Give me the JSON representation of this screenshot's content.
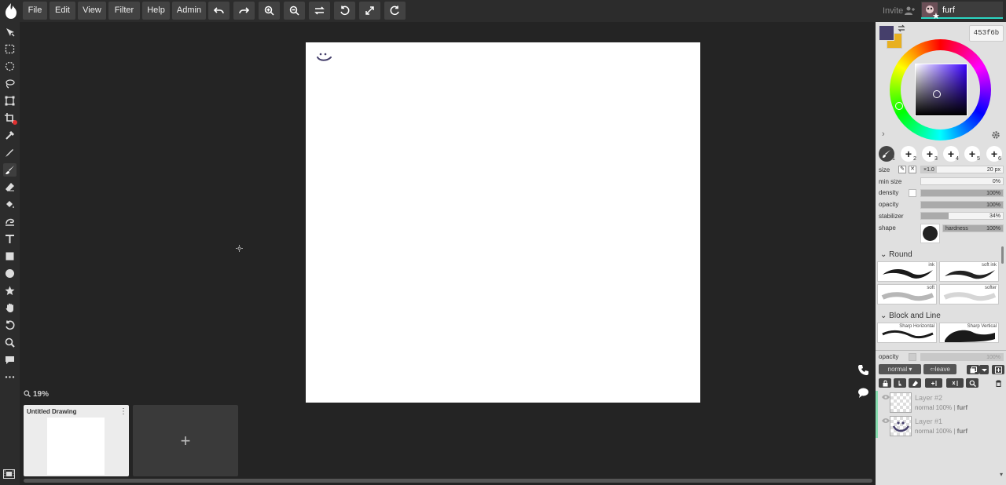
{
  "menu": {
    "file": "File",
    "edit": "Edit",
    "view": "View",
    "filter": "Filter",
    "help": "Help",
    "admin": "Admin"
  },
  "toolbar_icons": [
    "undo-icon",
    "redo-icon",
    "zoom-in-icon",
    "zoom-out-icon",
    "flip-icon",
    "rotate-icon",
    "fullscreen-icon",
    "reset-icon"
  ],
  "session": {
    "invite_label": "Invite",
    "username": "furf"
  },
  "tools": [
    "move",
    "rect-select",
    "ellipse-select",
    "lasso",
    "transform",
    "crop",
    "eyedropper",
    "pen",
    "brush",
    "eraser",
    "fill",
    "smudge",
    "text",
    "rectangle",
    "ellipse",
    "shape",
    "hand",
    "rotate",
    "zoom",
    "comment",
    "more"
  ],
  "canvas": {
    "zoom_label": "19%"
  },
  "documents": {
    "current_title": "Untitled Drawing",
    "add_label": "+"
  },
  "color": {
    "hex": "453f6b",
    "primary": "#453f6b",
    "secondary": "#e8b020"
  },
  "brush_slots": [
    "1",
    "2",
    "3",
    "4",
    "5",
    "6"
  ],
  "brush_settings": {
    "size_label": "size",
    "size_mult": "×1.0",
    "size_value": "20 px",
    "min_size_label": "min size",
    "min_size_value": "0%",
    "min_size_fraction": 0.0,
    "density_label": "density",
    "density_value": "100%",
    "density_fraction": 1.0,
    "opacity_label": "opacity",
    "opacity_value": "100%",
    "opacity_fraction": 1.0,
    "stabilizer_label": "stabilizer",
    "stabilizer_value": "34%",
    "stabilizer_fraction": 0.34,
    "shape_label": "shape",
    "hardness_label": "hardness",
    "hardness_value": "100%",
    "hardness_fraction": 1.0
  },
  "brush_library": {
    "round_title": "Round",
    "round": [
      "ink",
      "soft ink",
      "soft",
      "softer"
    ],
    "block_title": "Block and Line",
    "block": [
      "Sharp Horizontal",
      "Sharp Vertical"
    ]
  },
  "layers_panel": {
    "opacity_label": "opacity",
    "opacity_value": "100%",
    "blend_mode": "normal",
    "leave_label": "leave",
    "layers": [
      {
        "name": "Layer #2",
        "meta": "normal 100% | ",
        "owner": "furf"
      },
      {
        "name": "Layer #1",
        "meta": "normal 100% | ",
        "owner": "furf"
      }
    ]
  }
}
